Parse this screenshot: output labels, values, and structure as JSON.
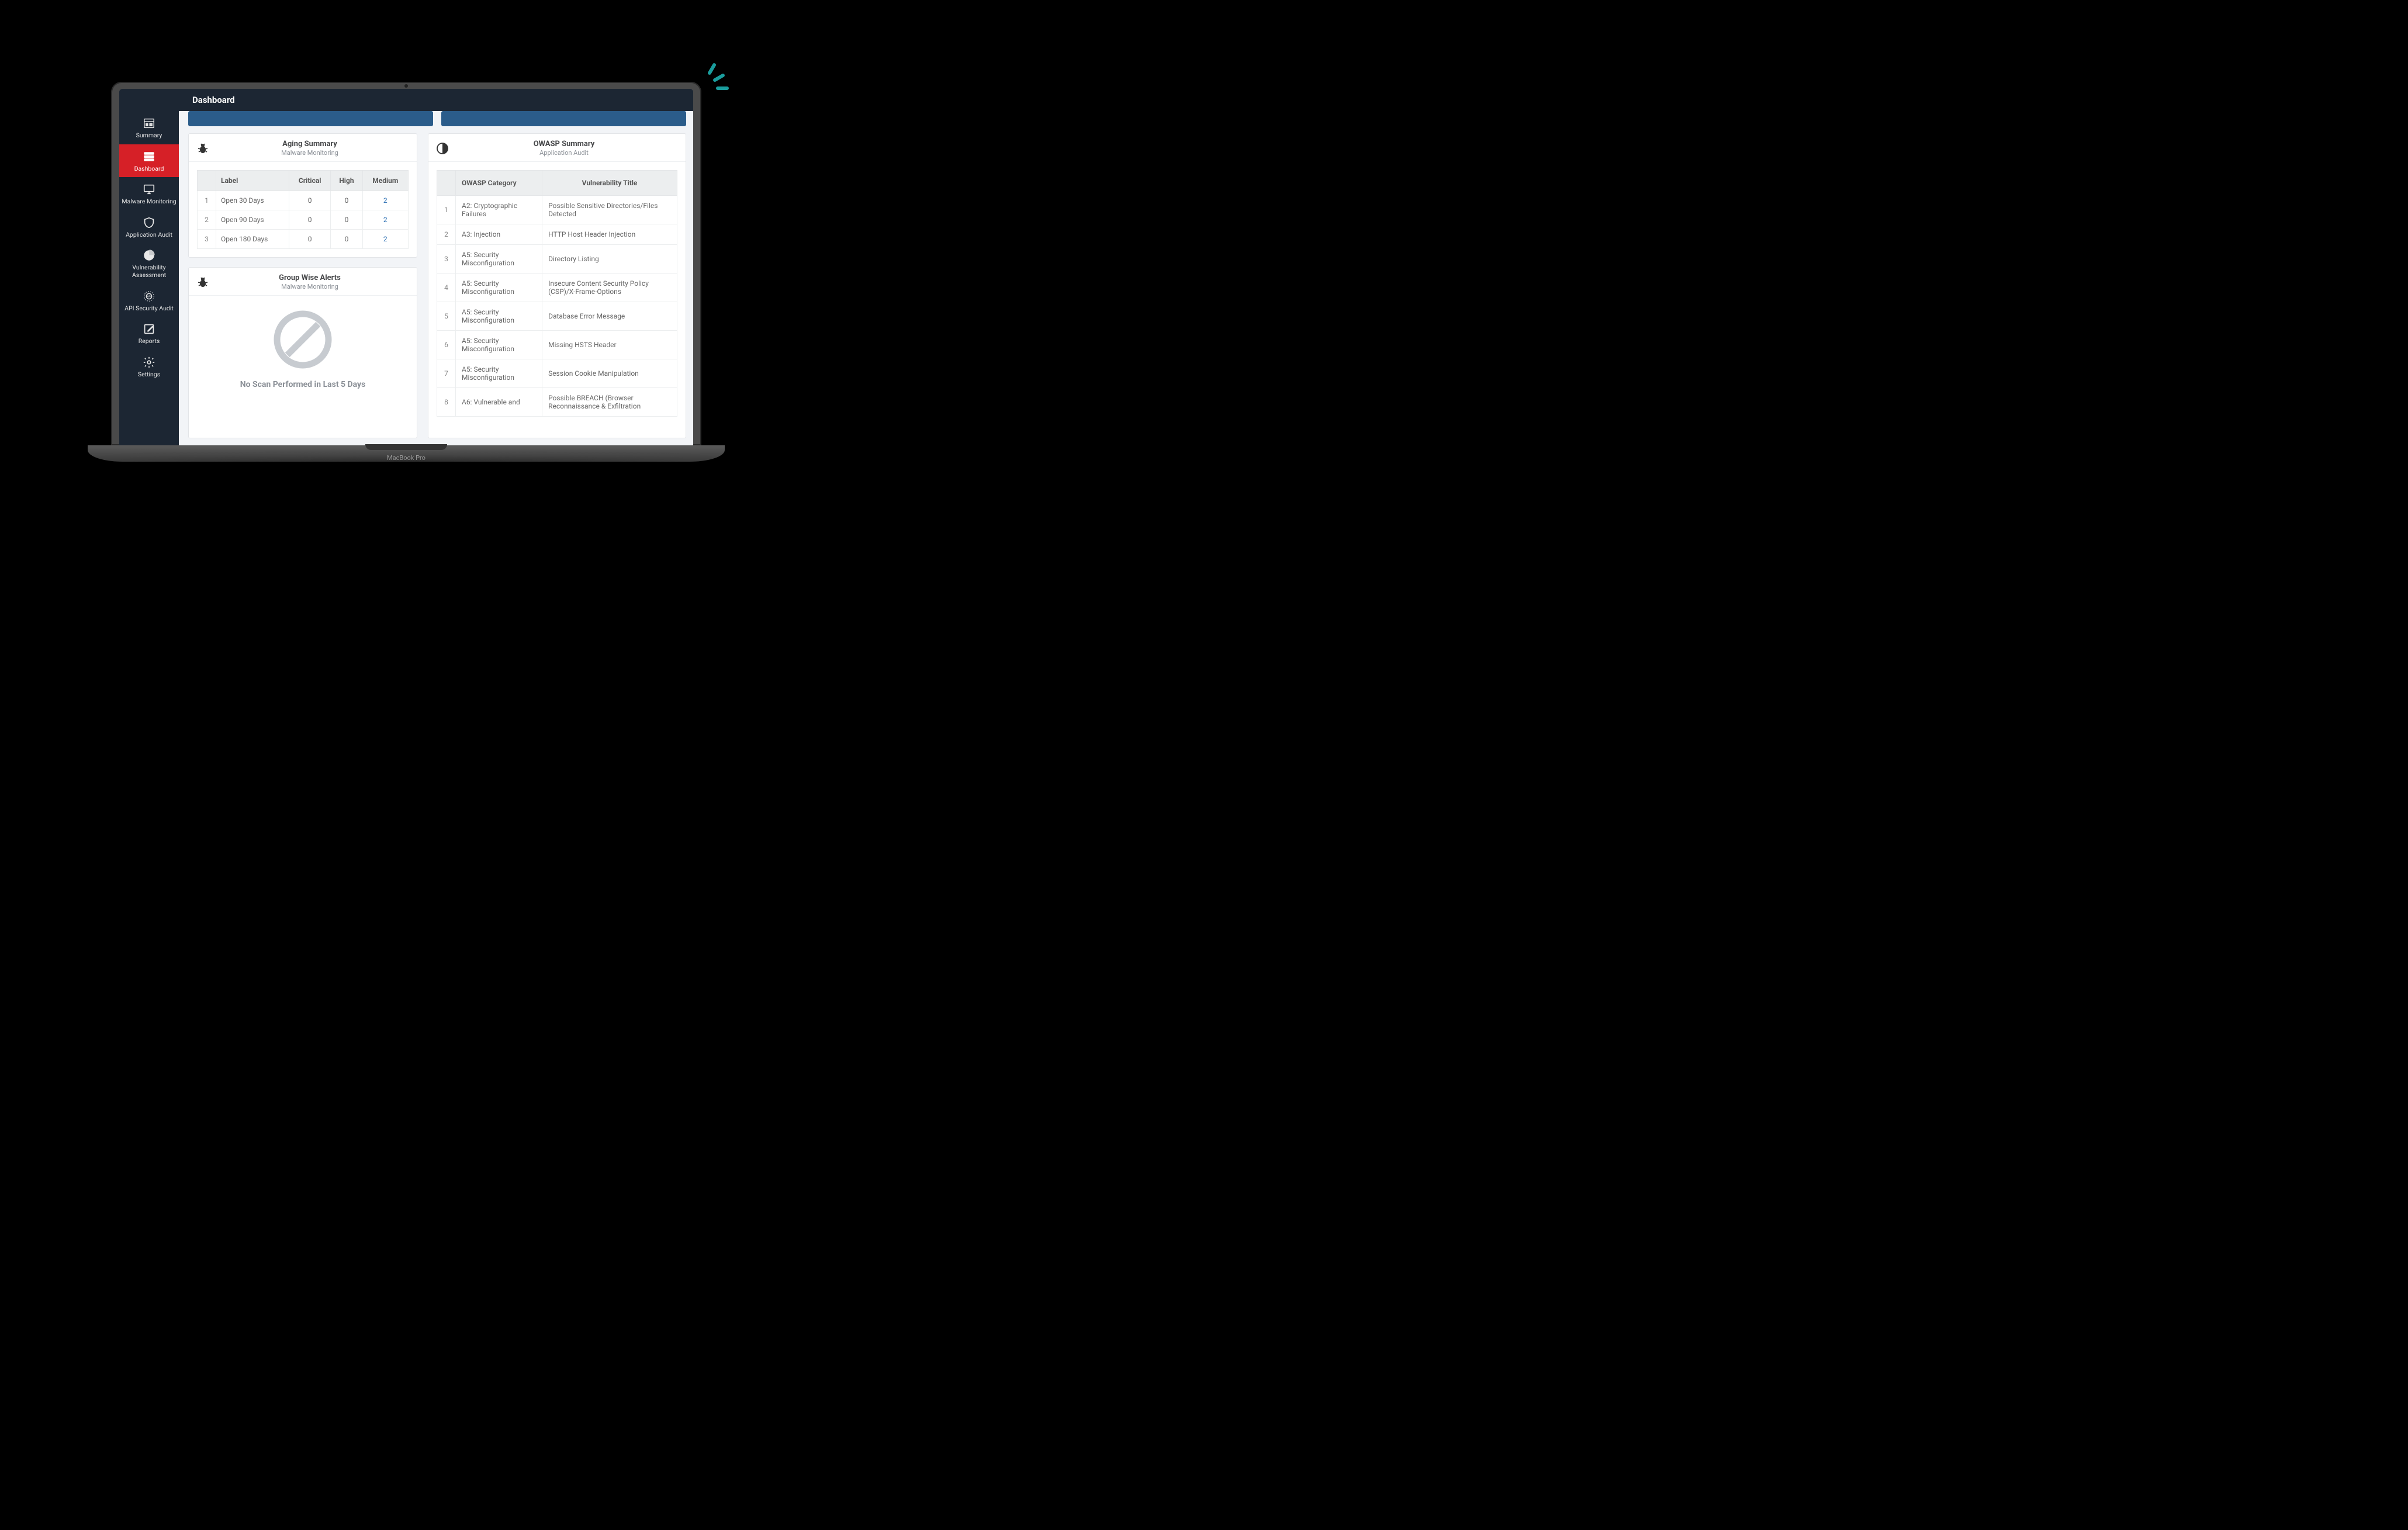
{
  "header": {
    "title": "Dashboard"
  },
  "laptop": {
    "brand": "MacBook Pro"
  },
  "sidebar": {
    "items": [
      {
        "label": "Summary",
        "icon": "summary",
        "active": false
      },
      {
        "label": "Dashboard",
        "icon": "dashboard",
        "active": true
      },
      {
        "label": "Malware Monitoring",
        "icon": "monitor",
        "active": false
      },
      {
        "label": "Application Audit",
        "icon": "shield",
        "active": false
      },
      {
        "label": "Vulnerability Assessment",
        "icon": "pie",
        "active": false
      },
      {
        "label": "API Security Audit",
        "icon": "api",
        "active": false
      },
      {
        "label": "Reports",
        "icon": "edit",
        "active": false
      },
      {
        "label": "Settings",
        "icon": "gear",
        "active": false
      }
    ]
  },
  "aging_card": {
    "title": "Aging Summary",
    "subtitle": "Malware Monitoring",
    "columns": {
      "label": "Label",
      "critical": "Critical",
      "high": "High",
      "medium": "Medium"
    },
    "rows": [
      {
        "idx": "1",
        "label": "Open 30 Days",
        "critical": "0",
        "high": "0",
        "medium": "2"
      },
      {
        "idx": "2",
        "label": "Open 90 Days",
        "critical": "0",
        "high": "0",
        "medium": "2"
      },
      {
        "idx": "3",
        "label": "Open 180 Days",
        "critical": "0",
        "high": "0",
        "medium": "2"
      }
    ]
  },
  "group_card": {
    "title": "Group Wise Alerts",
    "subtitle": "Malware Monitoring",
    "empty_text": "No Scan Performed in Last 5 Days"
  },
  "owasp_card": {
    "title": "OWASP Summary",
    "subtitle": "Application Audit",
    "columns": {
      "category": "OWASP Category",
      "vuln": "Vulnerability Title"
    },
    "rows": [
      {
        "idx": "1",
        "category": "A2: Cryptographic Failures",
        "vuln": "Possible Sensitive Directories/Files Detected"
      },
      {
        "idx": "2",
        "category": "A3: Injection",
        "vuln": "HTTP Host Header Injection"
      },
      {
        "idx": "3",
        "category": "A5: Security Misconfiguration",
        "vuln": "Directory Listing"
      },
      {
        "idx": "4",
        "category": "A5: Security Misconfiguration",
        "vuln": "Insecure Content Security Policy (CSP)/X-Frame-Options"
      },
      {
        "idx": "5",
        "category": "A5: Security Misconfiguration",
        "vuln": "Database Error Message"
      },
      {
        "idx": "6",
        "category": "A5: Security Misconfiguration",
        "vuln": "Missing HSTS Header"
      },
      {
        "idx": "7",
        "category": "A5: Security Misconfiguration",
        "vuln": "Session Cookie Manipulation"
      },
      {
        "idx": "8",
        "category": "A6: Vulnerable and",
        "vuln": "Possible BREACH (Browser Reconnaissance & Exfiltration"
      }
    ]
  }
}
